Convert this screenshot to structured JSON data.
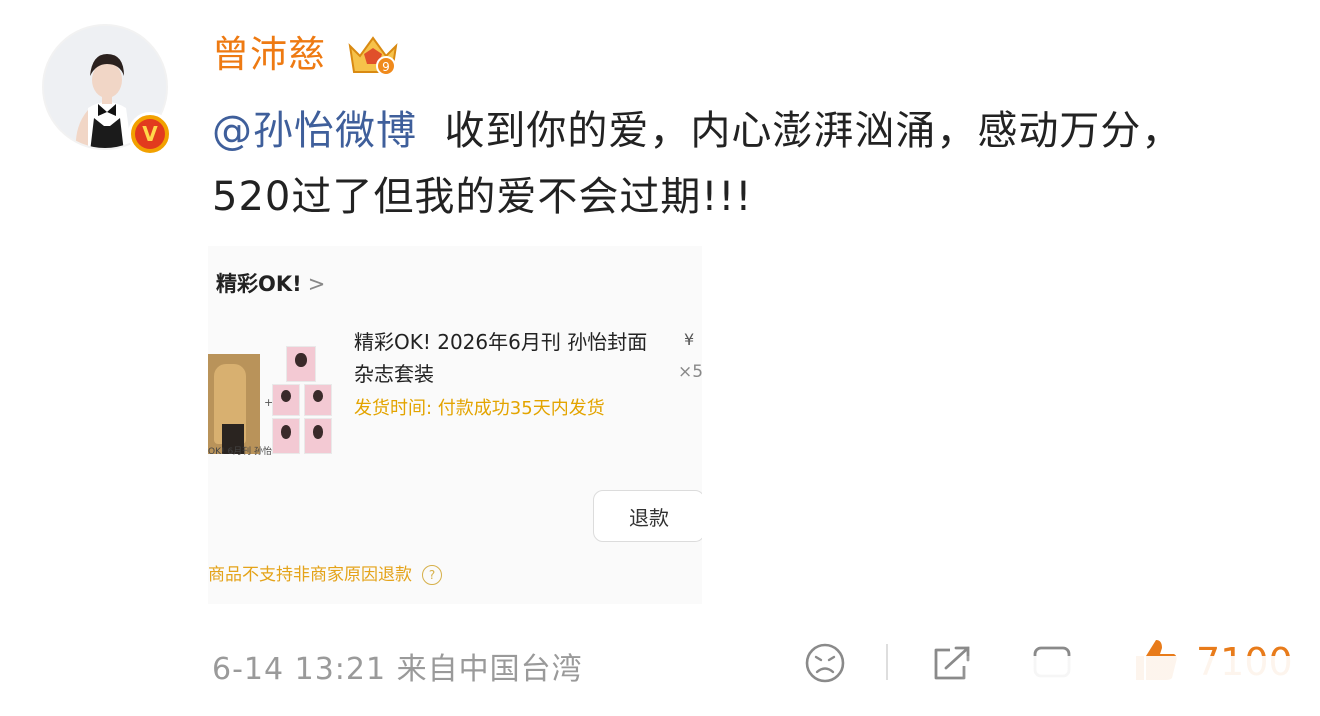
{
  "author": {
    "name": "曾沛慈",
    "avatar_icon": "user-avatar",
    "verified_badge": "verified-v-icon",
    "level_badge": "crown-level-icon",
    "level": "9"
  },
  "post": {
    "mention": "@孙怡微博",
    "text": "收到你的爱，内心澎湃汹涌，感动万分，520过了但我的爱不会过期!!!"
  },
  "embedded_order": {
    "shop_name": "精彩OK!",
    "shop_chevron": ">",
    "product_title": "精彩OK! 2026年6月刊 孙怡封面杂志套装",
    "thumb_caption": "OK! 6月刊 孙怡",
    "price_symbol": "¥",
    "quantity": "×5",
    "shipping": "发货时间: 付款成功35天内发货",
    "refund_button": "退款",
    "policy": "商品不支持非商家原因退款",
    "policy_help": "?"
  },
  "footer": {
    "date": "6-14 13:21",
    "source": "来自中国台湾",
    "likes": "7100"
  },
  "colors": {
    "username": "#ee7a12",
    "mention": "#3f5f9b",
    "shipping": "#e3a400",
    "likes": "#e87b1a"
  }
}
